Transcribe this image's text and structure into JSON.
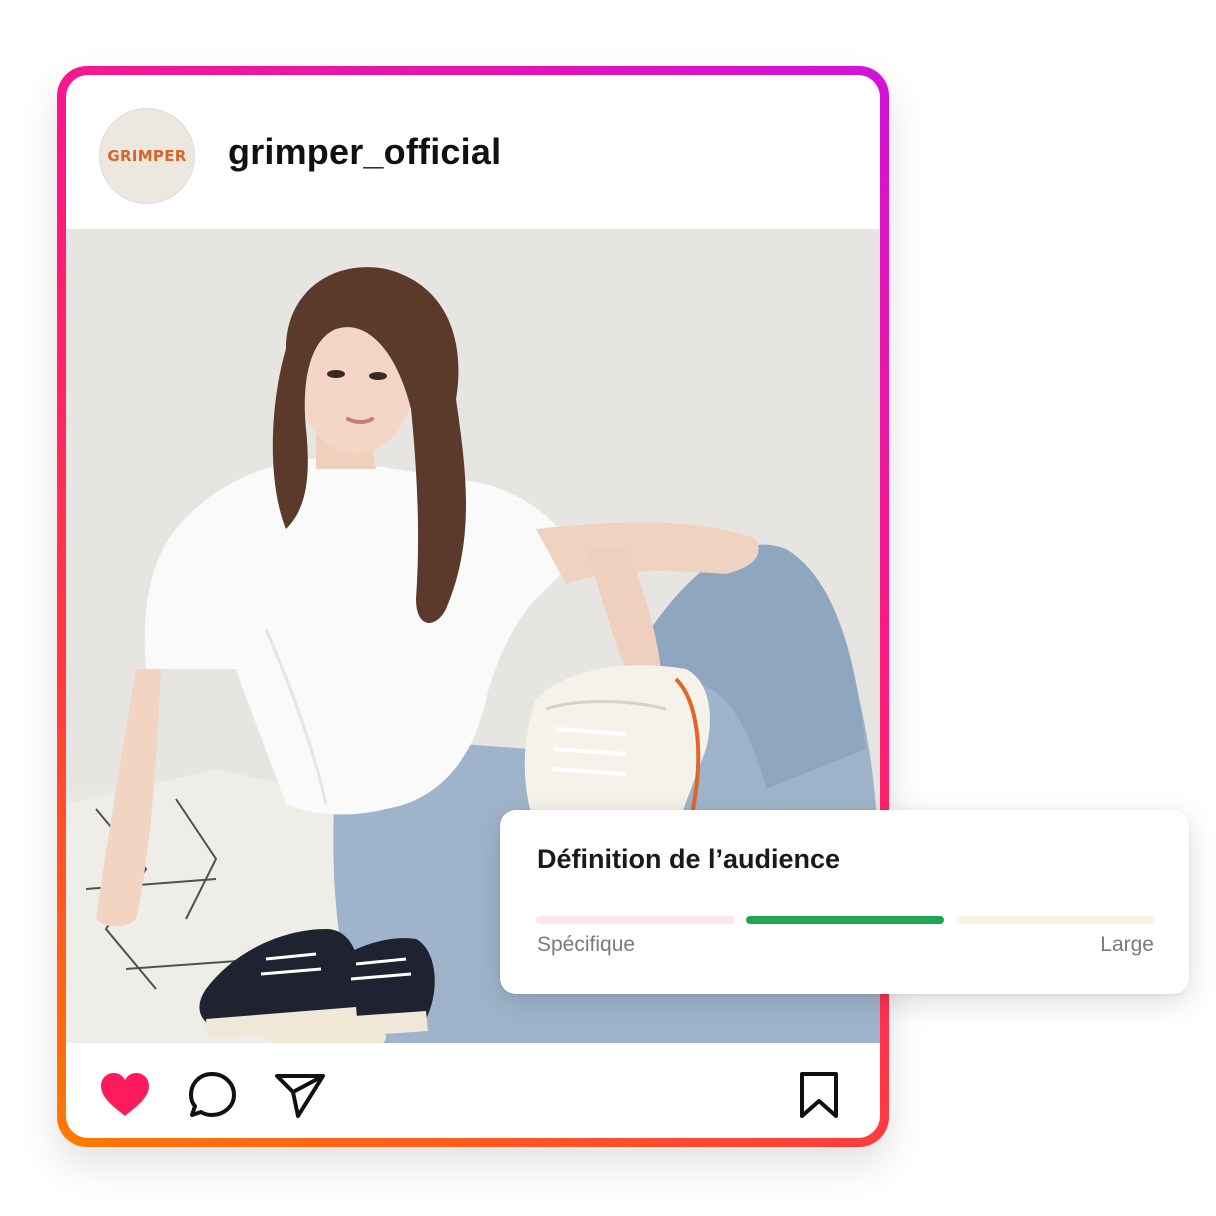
{
  "post": {
    "username": "grimper_official",
    "avatar_text": "GRIMPER",
    "photo_alt": "",
    "actions": {
      "like_icon": "heart-filled-icon",
      "comment_icon": "comment-bubble-icon",
      "share_icon": "paper-plane-icon",
      "save_icon": "bookmark-icon"
    }
  },
  "audience": {
    "title": "Définition de l’audience",
    "label_left": "Spécifique",
    "label_right": "Large",
    "selected_segment": 2,
    "segment_count": 3
  },
  "colors": {
    "gradient": [
      "#ff7a00",
      "#ff3d3d",
      "#ff1a7a",
      "#d112d9"
    ],
    "like": "#ff1a5e",
    "brand_orange": "#d8642a",
    "segment_left": "#fde6ee",
    "segment_active": "#1fa651",
    "segment_right": "#f7f1e4"
  }
}
